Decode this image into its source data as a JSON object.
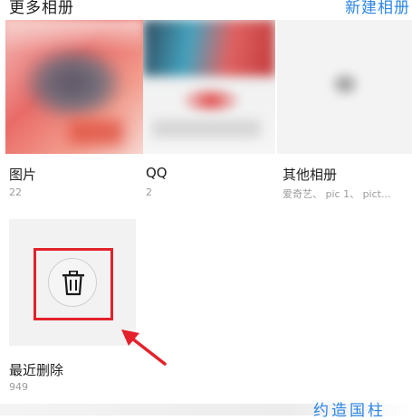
{
  "header": {
    "title": "更多相册",
    "new_album_label": "新建相册"
  },
  "albums": [
    {
      "name": "图片",
      "count": "22"
    },
    {
      "name": "QQ",
      "count": "2"
    },
    {
      "name": "其他相册",
      "count": "爱奇艺、 pic 1、 pict..."
    }
  ],
  "trash": {
    "name": "最近删除",
    "count": "949",
    "icon": "trash-icon"
  },
  "annotation": {
    "highlight_color": "#e3222b"
  },
  "footer": {
    "partial_link": "约造国柱"
  },
  "colors": {
    "accent": "#2b85e4",
    "title": "#1d1d1d",
    "count": "#9a9a9a"
  }
}
